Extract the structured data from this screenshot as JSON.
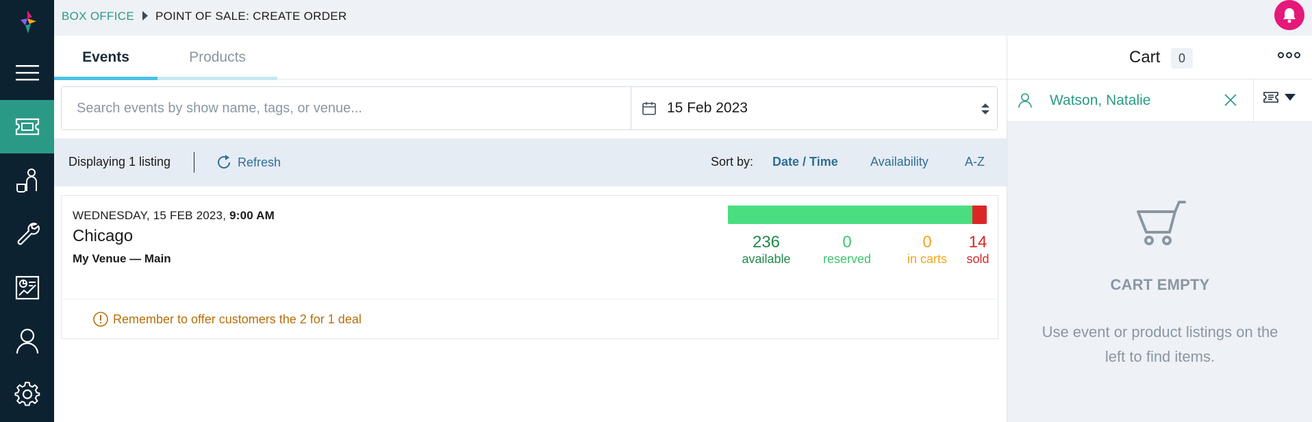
{
  "breadcrumb": {
    "root": "BOX OFFICE",
    "current": "POINT OF SALE: CREATE ORDER"
  },
  "nav": {
    "items": [
      {
        "icon": "menu-icon",
        "active": false
      },
      {
        "icon": "ticket-icon",
        "active": true
      },
      {
        "icon": "customer-service-icon",
        "active": false
      },
      {
        "icon": "wrench-icon",
        "active": false
      },
      {
        "icon": "report-icon",
        "active": false
      },
      {
        "icon": "user-icon",
        "active": false
      },
      {
        "icon": "gear-icon",
        "active": false
      }
    ]
  },
  "tabs": [
    {
      "label": "Events",
      "active": true
    },
    {
      "label": "Products",
      "active": false
    }
  ],
  "search": {
    "placeholder": "Search events by show name, tags, or venue...",
    "value": "",
    "date": "15 Feb 2023"
  },
  "listing": {
    "count_text": "Displaying 1 listing",
    "refresh_label": "Refresh",
    "sort_label": "Sort by:",
    "sort_options": [
      "Date / Time",
      "Availability",
      "A-Z"
    ],
    "sort_active": "Date / Time"
  },
  "event": {
    "date_text": "WEDNESDAY, 15 FEB 2023,",
    "time_text": "9:00 AM",
    "title": "Chicago",
    "venue": "My Venue — Main",
    "stats": {
      "available": "236",
      "available_label": "available",
      "reserved": "0",
      "reserved_label": "reserved",
      "in_carts": "0",
      "in_carts_label": "in carts",
      "sold": "14",
      "sold_label": "sold"
    },
    "capacity": {
      "available": 236,
      "reserved": 0,
      "in_carts": 0,
      "sold": 14
    },
    "note": "Remember to offer customers the 2 for 1 deal"
  },
  "cart": {
    "title": "Cart",
    "count": "0",
    "customer": "Watson, Natalie",
    "empty_title": "CART EMPTY",
    "empty_message": "Use event or product listings on the left to find items."
  },
  "colors": {
    "sidebar": "#0d2231",
    "accent_teal": "#2a9a86",
    "notification": "#e5197a",
    "available": "#4ade80",
    "sold": "#dc2626",
    "in_carts": "#f2a51a"
  }
}
